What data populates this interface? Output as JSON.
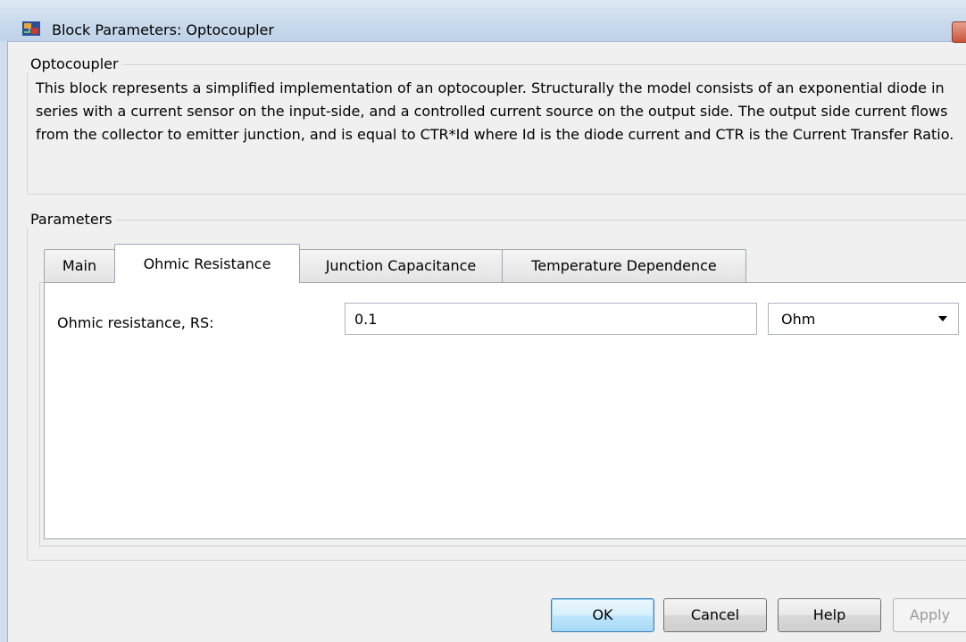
{
  "window": {
    "title": "Block Parameters: Optocoupler"
  },
  "description_group": {
    "label": "Optocoupler",
    "text": "This block represents a simplified implementation of an optocoupler. Structurally the model consists of an exponential diode in series with a current sensor on the input-side, and a controlled current source on the output side. The output side current flows from the collector to emitter junction, and is equal to CTR*Id where Id is the diode current and CTR is the Current Transfer Ratio."
  },
  "parameters": {
    "label": "Parameters",
    "tabs": [
      {
        "label": "Main",
        "active": false
      },
      {
        "label": "Ohmic Resistance",
        "active": true
      },
      {
        "label": "Junction Capacitance",
        "active": false
      },
      {
        "label": "Temperature Dependence",
        "active": false
      }
    ],
    "fields": [
      {
        "label": "Ohmic resistance, RS:",
        "value": "0.1",
        "unit": "Ohm"
      }
    ]
  },
  "buttons": {
    "ok": "OK",
    "cancel": "Cancel",
    "help": "Help",
    "apply": "Apply"
  }
}
